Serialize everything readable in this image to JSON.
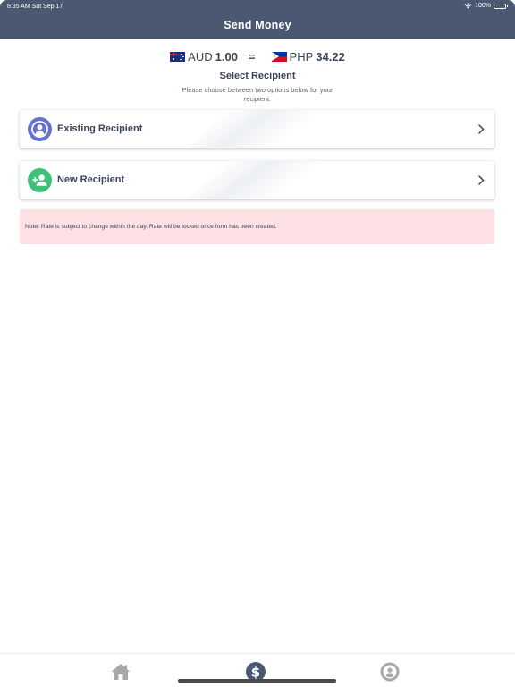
{
  "status_bar": {
    "time": "8:35 AM  Sat Sep 17",
    "battery": "100%"
  },
  "header": {
    "title": "Send Money"
  },
  "rate": {
    "from_code": "AUD",
    "from_value": "1.00",
    "equals": "=",
    "to_code": "PHP",
    "to_value": "34.22"
  },
  "select": {
    "title": "Select Recipient",
    "description": "Please choose between two options below for your recipient:"
  },
  "options": [
    {
      "label": "Existing Recipient",
      "icon": "person-circle-icon"
    },
    {
      "label": "New Recipient",
      "icon": "add-person-icon"
    }
  ],
  "note": {
    "text": "Note: Rate is subject to change within the day. Rate will be locked once form has been created."
  },
  "tabs": [
    {
      "name": "home",
      "icon": "home-icon"
    },
    {
      "name": "send-money",
      "icon": "dollar-icon",
      "active": true
    },
    {
      "name": "profile",
      "icon": "profile-icon"
    }
  ],
  "colors": {
    "header": "#4a5872",
    "existing_icon": "#6272d6",
    "new_icon": "#3cc07a",
    "note_bg": "#fde0e4",
    "tab_active": "#4a5872",
    "tab_inactive": "#a8a8a8"
  }
}
